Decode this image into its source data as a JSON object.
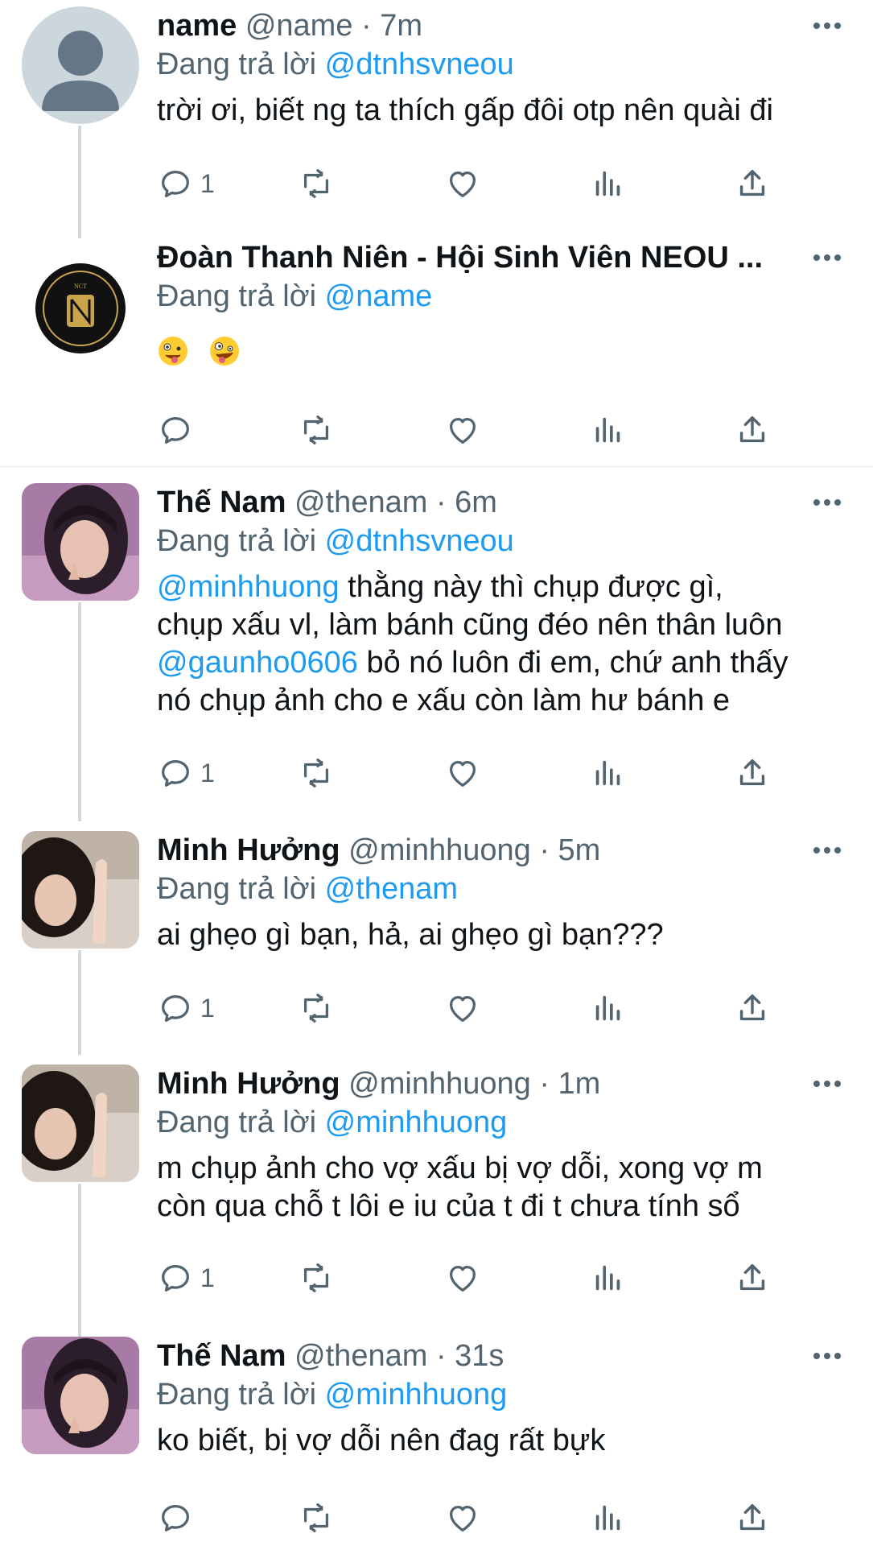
{
  "colors": {
    "link": "#1d9bf0",
    "muted": "#536471",
    "text": "#0f1419",
    "thread_line": "#cfd9de",
    "separator": "#eff3f4"
  },
  "tweets": [
    {
      "display_name": "name",
      "handle": "@name",
      "dot": "·",
      "time": "7m",
      "reply_prefix": "Đang trả lời",
      "reply_to": "@dtnhsvneou",
      "body": "trời ơi, biết ng ta thích gấp đôi otp nên quài đi",
      "reply_count": "1",
      "avatar_icon": "default-profile-avatar"
    },
    {
      "display_name": "Đoàn Thanh Niên - Hội Sinh Viên NEOU ...",
      "reply_prefix": "Đang trả lời",
      "reply_to": "@name",
      "emojis": [
        "zany-face-emoji",
        "zany-face-emoji"
      ],
      "avatar_icon": "nct-logo-avatar",
      "logo_text": "NCT"
    },
    {
      "display_name": "Thế Nam",
      "handle": "@thenam",
      "dot": "·",
      "time": "6m",
      "reply_prefix": "Đang trả lời",
      "reply_to": "@dtnhsvneou",
      "mention1": "@minhhuong",
      "body1": " thằng này thì chụp được gì,",
      "body2": "chụp xấu vl, làm bánh cũng đéo nên thân luôn",
      "mention2": "@gaunho0606",
      "body3": " bỏ nó luôn đi em, chứ anh thấy",
      "body4": "nó chụp ảnh cho e xấu còn làm hư bánh e",
      "reply_count": "1",
      "avatar_icon": "photo-avatar"
    },
    {
      "display_name": "Minh Hưởng",
      "handle": "@minhhuong",
      "dot": "·",
      "time": "5m",
      "reply_prefix": "Đang trả lời",
      "reply_to": "@thenam",
      "body": "ai ghẹo gì bạn, hả, ai ghẹo gì bạn???",
      "reply_count": "1",
      "avatar_icon": "photo-avatar"
    },
    {
      "display_name": "Minh Hưởng",
      "handle": "@minhhuong",
      "dot": "·",
      "time": "1m",
      "reply_prefix": "Đang trả lời",
      "reply_to": "@minhhuong",
      "body1": "m chụp ảnh cho vợ xấu bị vợ dỗi, xong vợ m",
      "body2": "còn qua chỗ t lôi e iu của t đi t chưa tính sổ",
      "reply_count": "1",
      "avatar_icon": "photo-avatar"
    },
    {
      "display_name": "Thế Nam",
      "handle": "@thenam",
      "dot": "·",
      "time": "31s",
      "reply_prefix": "Đang trả lời",
      "reply_to": "@minhhuong",
      "body": "ko biết, bị vợ dỗi nên đag rất bựk",
      "avatar_icon": "photo-avatar"
    }
  ]
}
